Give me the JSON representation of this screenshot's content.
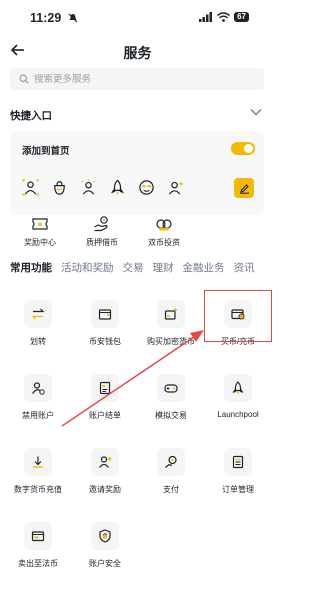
{
  "status": {
    "time": "11:29",
    "battery": "67"
  },
  "header": {
    "title": "服务"
  },
  "search": {
    "placeholder": "搜索更多服务"
  },
  "quick": {
    "title": "快捷入口",
    "add_to_home": "添加到首页",
    "toggle_on": true,
    "mini_icons": [
      "user-group-icon",
      "lock-bag-icon",
      "user-sparkle-icon",
      "rocket-icon",
      "face-sunglasses-icon",
      "user-plus-icon"
    ],
    "items": [
      {
        "label": "奖励中心",
        "icon": "ticket-icon"
      },
      {
        "label": "质押借币",
        "icon": "hand-coin-icon"
      },
      {
        "label": "双币投资",
        "icon": "double-coin-icon"
      }
    ]
  },
  "tabs": [
    "常用功能",
    "活动和奖励",
    "交易",
    "理财",
    "金融业务",
    "资讯"
  ],
  "active_tab": "常用功能",
  "grid": [
    {
      "label": "划转",
      "icon": "transfer-icon"
    },
    {
      "label": "币安钱包",
      "icon": "wallet-icon"
    },
    {
      "label": "购买加密货币",
      "icon": "card-plus-icon"
    },
    {
      "label": "买币/充币",
      "icon": "buy-deposit-icon"
    },
    {
      "label": "禁用账户",
      "icon": "user-disable-icon"
    },
    {
      "label": "账户结单",
      "icon": "statement-icon"
    },
    {
      "label": "模拟交易",
      "icon": "gamepad-icon"
    },
    {
      "label": "Launchpool",
      "icon": "rocket-icon"
    },
    {
      "label": "数字货币充值",
      "icon": "download-icon"
    },
    {
      "label": "邀请奖励",
      "icon": "invite-user-icon"
    },
    {
      "label": "支付",
      "icon": "pay-icon"
    },
    {
      "label": "订单管理",
      "icon": "order-list-icon"
    },
    {
      "label": "卖出至法币",
      "icon": "sell-fiat-icon"
    },
    {
      "label": "账户安全",
      "icon": "shield-lock-icon"
    }
  ],
  "colors": {
    "accent": "#f0b90b",
    "highlight": "#e34b4b",
    "text": "#1e2329",
    "muted": "#707a8a"
  }
}
